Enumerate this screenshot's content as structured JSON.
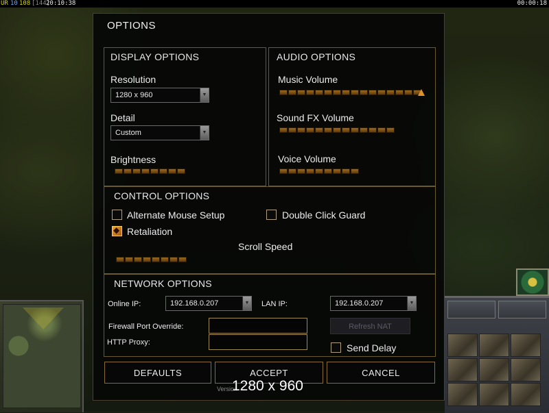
{
  "topbar": {
    "ur": "UR",
    "count_a": "10",
    "count_b": "108",
    "count_c": "[144]",
    "clock": "20:10:38",
    "timer": "00:00:18"
  },
  "dialog": {
    "title": "OPTIONS",
    "display": {
      "title": "DISPLAY OPTIONS",
      "resolution_label": "Resolution",
      "resolution_value": "1280 x 960",
      "detail_label": "Detail",
      "detail_value": "Custom",
      "brightness_label": "Brightness",
      "brightness_level": 0.5
    },
    "audio": {
      "title": "AUDIO OPTIONS",
      "music_label": "Music Volume",
      "music_level": 1.0,
      "sfx_label": "Sound FX Volume",
      "sfx_level": 1.0,
      "voice_label": "Voice Volume",
      "voice_level": 0.7
    },
    "control": {
      "title": "CONTROL OPTIONS",
      "alt_mouse_label": "Alternate Mouse Setup",
      "alt_mouse_checked": false,
      "double_click_label": "Double Click Guard",
      "double_click_checked": false,
      "retaliation_label": "Retaliation",
      "retaliation_checked": true,
      "scroll_label": "Scroll Speed",
      "scroll_level": 0.5
    },
    "network": {
      "title": "NETWORK OPTIONS",
      "online_ip_label": "Online IP:",
      "online_ip_value": "192.168.0.207",
      "lan_ip_label": "LAN IP:",
      "lan_ip_value": "192.168.0.207",
      "firewall_label": "Firewall Port Override:",
      "firewall_value": "",
      "proxy_label": "HTTP Proxy:",
      "proxy_value": "",
      "refresh_nat_label": "Refresh NAT",
      "send_delay_label": "Send Delay",
      "send_delay_checked": false
    },
    "buttons": {
      "defaults": "DEFAULTS",
      "accept": "ACCEPT",
      "cancel": "CANCEL"
    },
    "version_text": "Version",
    "overlay_resolution": "1280 x 960"
  },
  "colors": {
    "accent": "#e0902a",
    "panel_border": "#6a5a2e",
    "slider_segment": "#9c6a1e"
  }
}
